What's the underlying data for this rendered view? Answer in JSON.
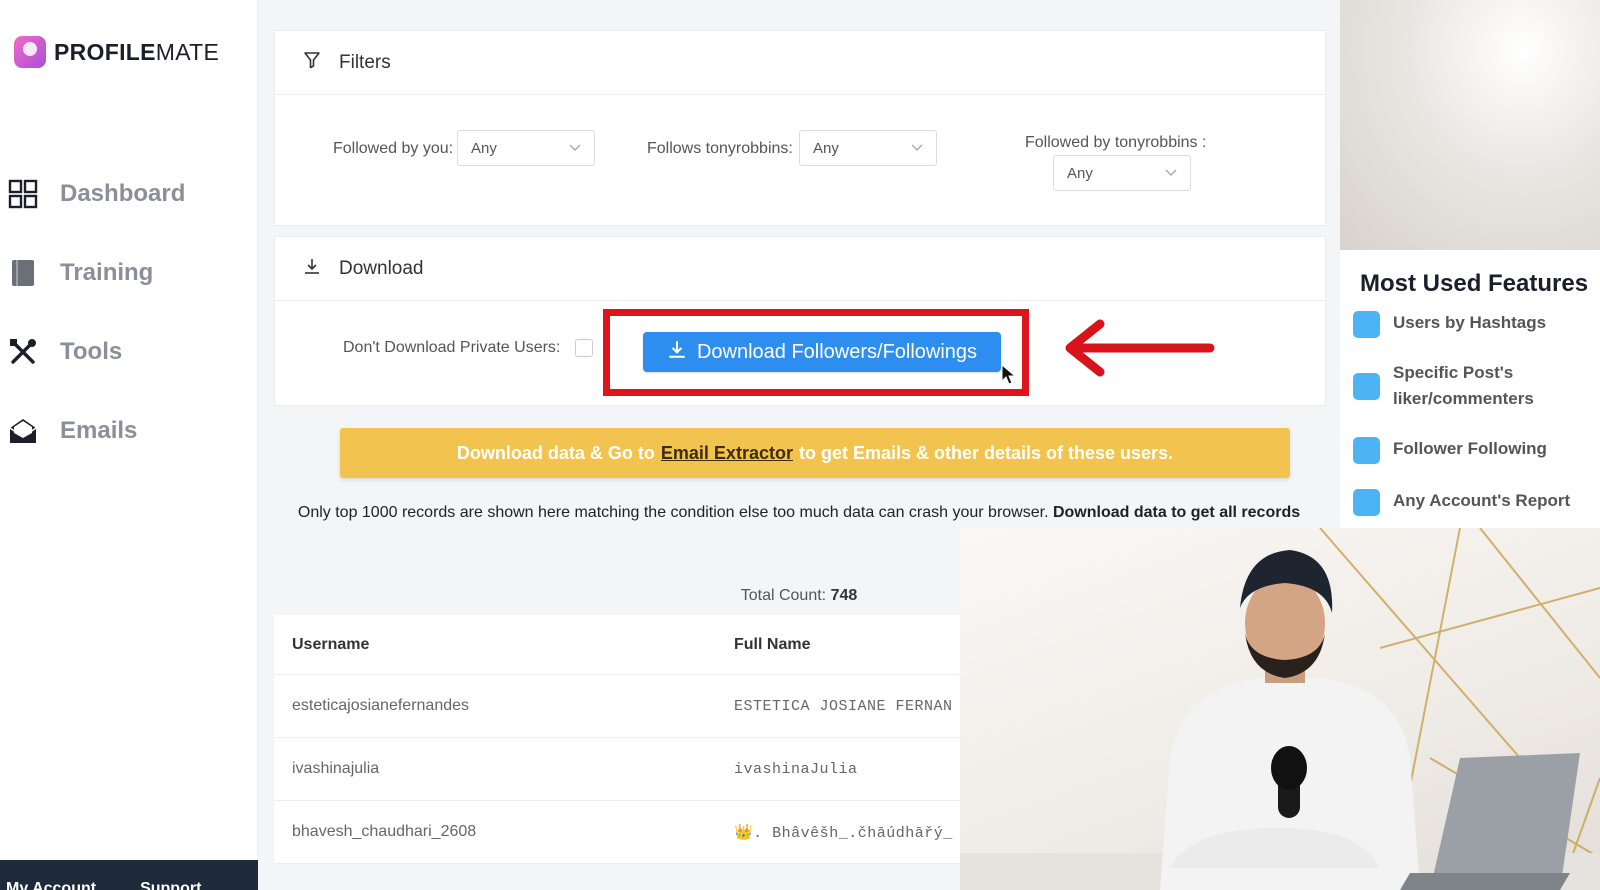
{
  "app": {
    "logo_bold": "PROFILE",
    "logo_light": "MATE"
  },
  "sidebar": {
    "items": [
      {
        "label": "Dashboard",
        "icon": "grid-icon"
      },
      {
        "label": "Training",
        "icon": "book-icon"
      },
      {
        "label": "Tools",
        "icon": "tools-icon"
      },
      {
        "label": "Emails",
        "icon": "envelope-icon"
      }
    ],
    "footer": {
      "account": "My Account",
      "support": "Support"
    }
  },
  "filters": {
    "title": "Filters",
    "followed_by_you": {
      "label": "Followed by you:",
      "value": "Any"
    },
    "follows_user": {
      "label": "Follows tonyrobbins:",
      "value": "Any"
    },
    "followed_by_user": {
      "label": "Followed by tonyrobbins :",
      "value": "Any"
    }
  },
  "download": {
    "title": "Download",
    "private_label": "Don't Download Private Users:",
    "button_label": "Download Followers/Followings"
  },
  "banner": {
    "before": "Download data & Go to",
    "link": "Email Extractor",
    "after": "to get Emails & other details of these users."
  },
  "notice": {
    "text": "Only top 1000 records are shown here matching the condition else too much data can crash your browser.",
    "bold": "Download data to get all records"
  },
  "total": {
    "label": "Total Count:",
    "value": "748"
  },
  "table": {
    "headers": [
      "Username",
      "Full Name"
    ],
    "rows": [
      [
        "esteticajosianefernandes",
        "ESTETICA JOSIANE FERNAN"
      ],
      [
        "ivashinajulia",
        "ivashinaJulia"
      ],
      [
        "bhavesh_chaudhari_2608",
        "👑. Bhâvêšh_.čhāúdhāřý_"
      ]
    ]
  },
  "features": {
    "title": "Most Used Features",
    "items": [
      "Users by Hashtags",
      "Specific Post's liker/commenters",
      "Follower Following",
      "Any Account's Report"
    ]
  },
  "colors": {
    "accent": "#2e8ef0",
    "highlight": "#e0141b",
    "banner": "#f3c34f",
    "feature": "#4cb4f5"
  }
}
